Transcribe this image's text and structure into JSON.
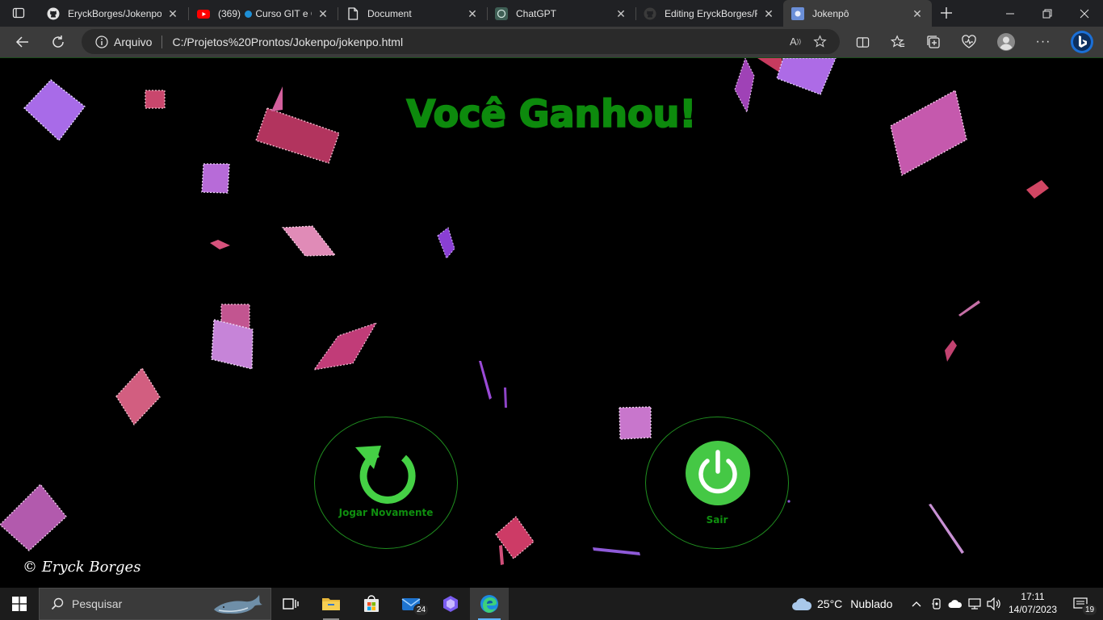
{
  "browser": {
    "tabs": [
      {
        "title": "EryckBorges/Jokenpo: ",
        "icon": "github-icon",
        "active": false
      },
      {
        "title": "(369) ",
        "title2": "Curso GIT e GitHub",
        "icon": "youtube-icon",
        "active": false
      },
      {
        "title": "Document",
        "icon": "document-icon",
        "active": false
      },
      {
        "title": "ChatGPT",
        "icon": "chatgpt-icon",
        "active": false
      },
      {
        "title": "Editing EryckBorges/README",
        "icon": "github-icon",
        "active": false
      },
      {
        "title": "Jokenpô",
        "icon": "jokenpo-favicon-icon",
        "active": true
      }
    ],
    "address": {
      "scheme_label": "Arquivo",
      "url": "C:/Projetos%20Prontos/Jokenpo/jokenpo.html"
    }
  },
  "page": {
    "title": "Você Ganhou!",
    "restart_label": "Jogar Novamente",
    "exit_label": "Sair",
    "copyright": "© Eryck Borges",
    "colors": {
      "accent": "#0d8a0d",
      "icon_green": "#45d145",
      "confetti_pink": "#c8507a",
      "confetti_purple": "#b070e0"
    }
  },
  "taskbar": {
    "search_placeholder": "Pesquisar",
    "mail_badge": "24",
    "weather": {
      "temp": "25°C",
      "condition": "Nublado"
    },
    "clock": {
      "time": "17:11",
      "date": "14/07/2023"
    },
    "notifications_badge": "19"
  }
}
